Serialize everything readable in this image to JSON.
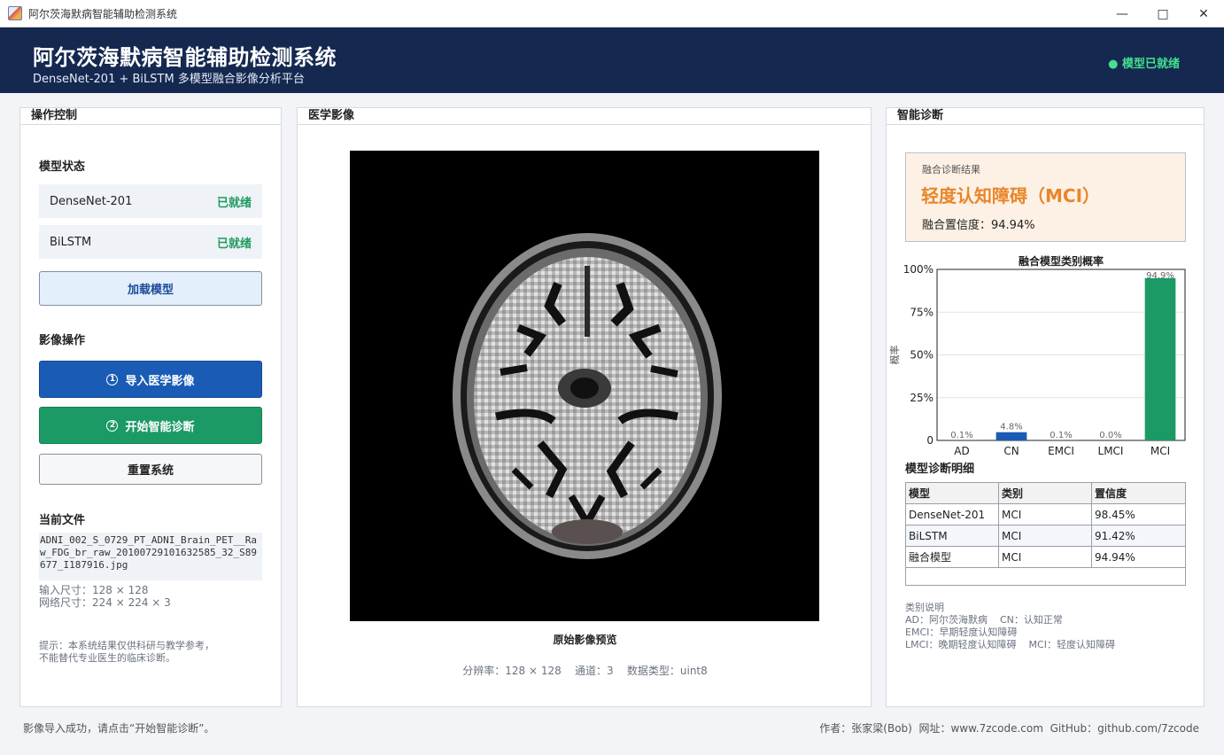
{
  "window": {
    "title": "阿尔茨海默病智能辅助检测系统"
  },
  "header": {
    "title": "阿尔茨海默病智能辅助检测系统",
    "subtitle": "DenseNet-201 + BiLSTM 多模型融合影像分析平台",
    "status": "● 模型已就绪"
  },
  "left": {
    "panel_title": "操作控制",
    "model_status_label": "模型状态",
    "models": [
      {
        "name": "DenseNet-201",
        "status": "已就绪"
      },
      {
        "name": "BiLSTM",
        "status": "已就绪"
      }
    ],
    "load_button": "加载模型",
    "image_ops_label": "影像操作",
    "import_button": "导入医学影像",
    "import_step": "1",
    "diagnose_button": "开始智能诊断",
    "diagnose_step": "2",
    "reset_button": "重置系统",
    "current_file_label": "当前文件",
    "current_file": "ADNI_002_S_0729_PT_ADNI_Brain_PET__Raw_FDG_br_raw_20100729101632585_32_S89677_I187916.jpg",
    "input_size": "输入尺寸：128 × 128",
    "net_size": "网络尺寸：224 × 224 × 3",
    "hint_line1": "提示：本系统结果仅供科研与教学参考，",
    "hint_line2": "不能替代专业医生的临床诊断。"
  },
  "center": {
    "panel_title": "医学影像",
    "preview_caption": "原始影像预览",
    "image_info": "分辨率：128 × 128    通道：3    数据类型：uint8"
  },
  "right": {
    "panel_title": "智能诊断",
    "result_label": "融合诊断结果",
    "result_value": "轻度认知障碍（MCI）",
    "result_confidence": "融合置信度：94.94%",
    "detail_title": "模型诊断明细",
    "table_headers": [
      "模型",
      "类别",
      "置信度"
    ],
    "table_rows": [
      [
        "DenseNet-201",
        "MCI",
        "98.45%"
      ],
      [
        "BiLSTM",
        "MCI",
        "91.42%"
      ],
      [
        "融合模型",
        "MCI",
        "94.94%"
      ]
    ],
    "legend_title": "类别说明",
    "legend_line1": "AD：阿尔茨海默病    CN：认知正常",
    "legend_line2": "EMCI：早期轻度认知障碍",
    "legend_line3": "LMCI：晚期轻度认知障碍    MCI：轻度认知障碍"
  },
  "chart_data": {
    "type": "bar",
    "title": "融合模型类别概率",
    "ylabel": "概率",
    "xlabel": "",
    "categories": [
      "AD",
      "CN",
      "EMCI",
      "LMCI",
      "MCI"
    ],
    "values": [
      0.1,
      4.8,
      0.1,
      0.0,
      94.9
    ],
    "data_labels": [
      "0.1%",
      "4.8%",
      "0.1%",
      "0.0%",
      "94.9%"
    ],
    "yticks": [
      "0",
      "25%",
      "50%",
      "75%",
      "100%"
    ],
    "ylim": [
      0,
      100
    ],
    "colors": [
      "#1a5bb5",
      "#1a5bb5",
      "#1a5bb5",
      "#1a5bb5",
      "#1c9a66"
    ]
  },
  "status_bar": {
    "message": "影像导入成功，请点击“开始智能诊断”。",
    "credits": "作者：张家梁(Bob)  网址：www.7zcode.com  GitHub：github.com/7zcode"
  },
  "colors": {
    "header_bg": "#142850",
    "ready_green": "#1e9a5f",
    "primary_blue": "#1a5bb5",
    "diagnose_green": "#1c9a66",
    "result_orange": "#e8862a"
  }
}
